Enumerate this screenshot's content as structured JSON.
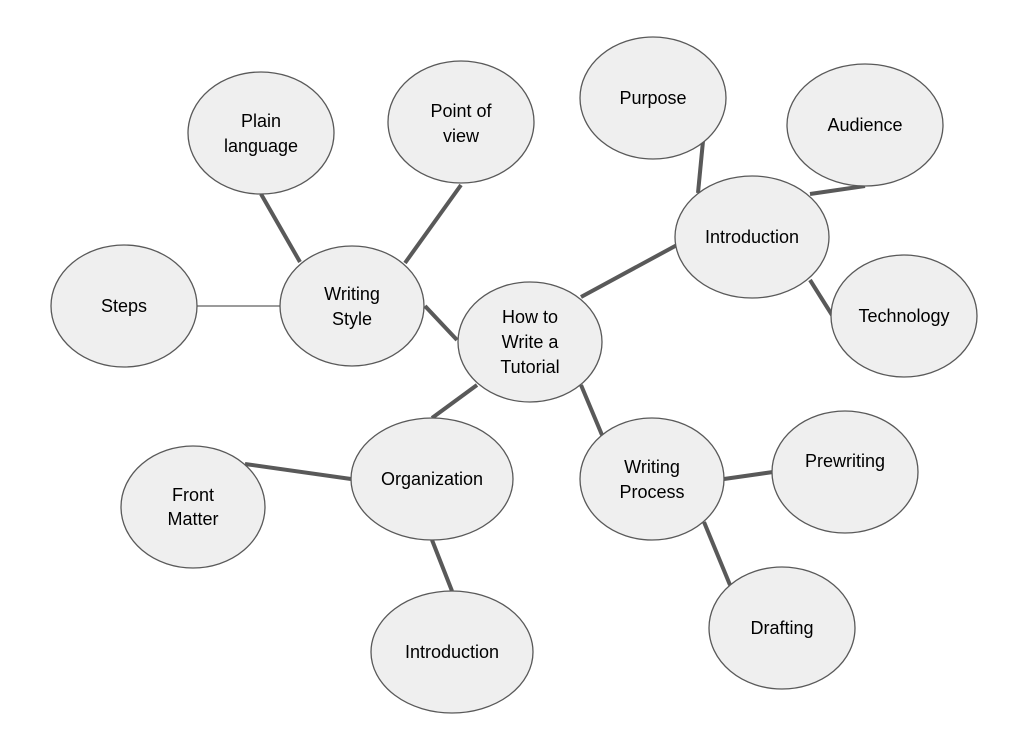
{
  "diagram": {
    "type": "mind-map",
    "root": "How to Write a Tutorial",
    "colors": {
      "node_fill": "#efefef",
      "node_stroke": "#595959",
      "edge": "#595959",
      "text": "#000000"
    },
    "nodes": [
      {
        "id": "root",
        "label": [
          "How to",
          "Write a",
          "Tutorial"
        ]
      },
      {
        "id": "writing-style",
        "label": [
          "Writing",
          "Style"
        ],
        "parent": "root"
      },
      {
        "id": "plain-language",
        "label": [
          "Plain",
          "language"
        ],
        "parent": "writing-style"
      },
      {
        "id": "point-of-view",
        "label": [
          "Point of",
          "view"
        ],
        "parent": "writing-style"
      },
      {
        "id": "steps",
        "label": [
          "Steps"
        ],
        "parent": "writing-style"
      },
      {
        "id": "introduction-main",
        "label": [
          "Introduction"
        ],
        "parent": "root"
      },
      {
        "id": "purpose",
        "label": [
          "Purpose"
        ],
        "parent": "introduction-main"
      },
      {
        "id": "audience",
        "label": [
          "Audience"
        ],
        "parent": "introduction-main"
      },
      {
        "id": "technology",
        "label": [
          "Technology"
        ],
        "parent": "introduction-main"
      },
      {
        "id": "organization",
        "label": [
          "Organization"
        ],
        "parent": "root"
      },
      {
        "id": "front-matter",
        "label": [
          "Front",
          "Matter"
        ],
        "parent": "organization"
      },
      {
        "id": "introduction-org",
        "label": [
          "Introduction"
        ],
        "parent": "organization"
      },
      {
        "id": "writing-process",
        "label": [
          "Writing",
          "Process"
        ],
        "parent": "root"
      },
      {
        "id": "prewriting",
        "label": [
          "Prewriting"
        ],
        "parent": "writing-process"
      },
      {
        "id": "drafting",
        "label": [
          "Drafting"
        ],
        "parent": "writing-process"
      }
    ]
  }
}
